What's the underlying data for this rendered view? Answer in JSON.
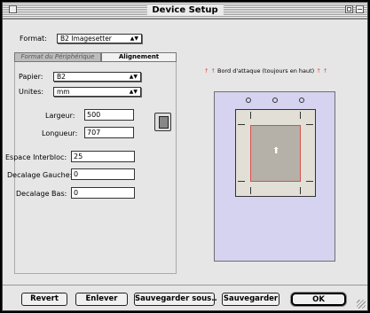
{
  "window": {
    "title": "Device Setup"
  },
  "format": {
    "label": "Format:",
    "value": "B2 Imagesetter"
  },
  "tabs": [
    {
      "label": "Format du Périphérique"
    },
    {
      "label": "Alignement"
    }
  ],
  "papier": {
    "label": "Papier:",
    "value": "B2"
  },
  "unites": {
    "label": "Unites:",
    "value": "mm"
  },
  "largeur": {
    "label": "Largeur:",
    "value": "500"
  },
  "longueur": {
    "label": "Longueur:",
    "value": "707"
  },
  "espace": {
    "label": "Espace Interbloc:",
    "value": "25"
  },
  "decalage_gauche": {
    "label": "Decalage Gauche:",
    "value": "0"
  },
  "decalage_bas": {
    "label": "Decalage Bas:",
    "value": "0"
  },
  "preview": {
    "banner": "Bord d'attaque (toujours en haut)"
  },
  "buttons": {
    "revert": "Revert",
    "enlever": "Enlever",
    "sauvegarder_sous": "Sauvegarder sous..",
    "sauvegarder": "Sauvegarder",
    "ok": "OK"
  },
  "colors": {
    "preview_bg": "#d5d3f0",
    "accent_red": "#e04a4a"
  }
}
